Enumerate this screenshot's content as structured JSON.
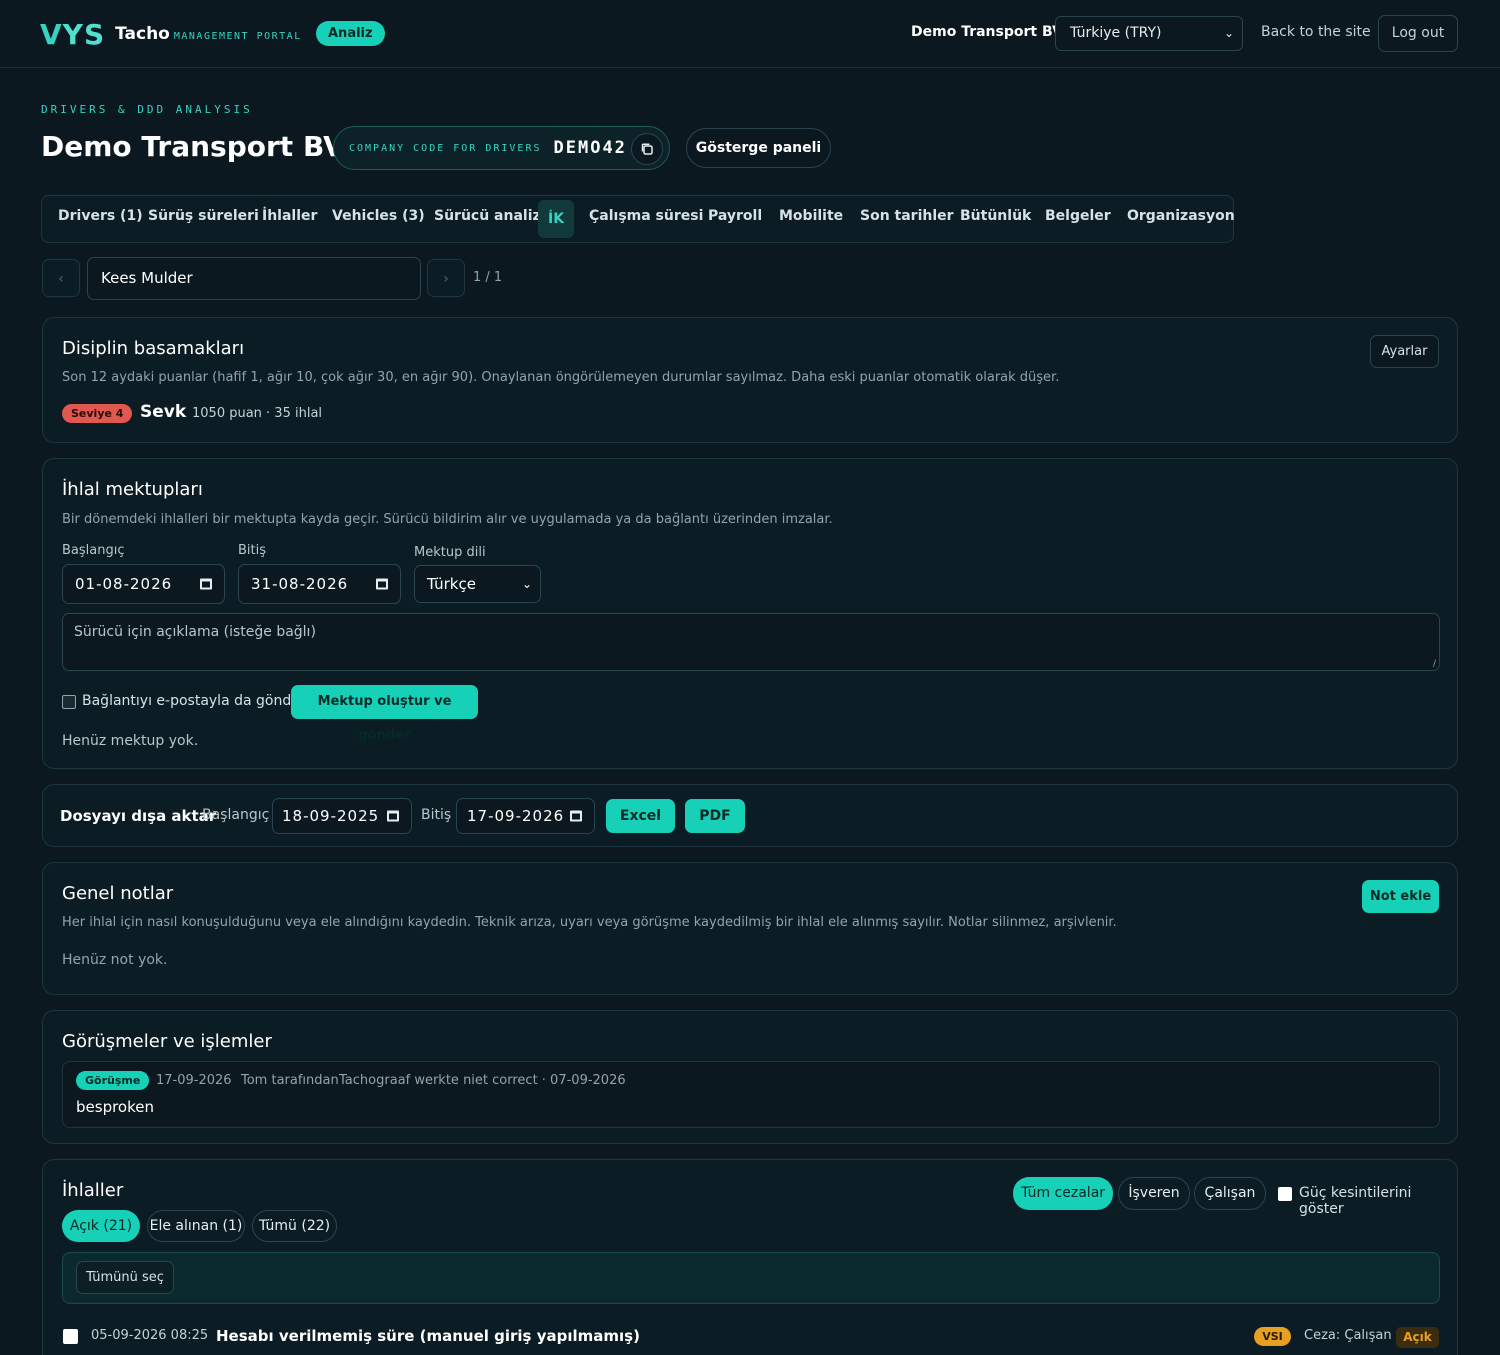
{
  "header": {
    "logo_mark_v": "V",
    "logo_mark_ys": "YS",
    "logo_text": "Tacho",
    "logo_sub": "MANAGEMENT PORTAL",
    "analiz_badge": "Analiz",
    "company": "Demo Transport BV",
    "country_select": "Türkiye (TRY)",
    "back_link": "Back to the site",
    "logout": "Log out"
  },
  "page": {
    "eyebrow": "DRIVERS & DDD ANALYSIS",
    "title": "Demo Transport BV",
    "code_label": "COMPANY CODE FOR DRIVERS",
    "code_value": "DEMO42",
    "dashboard_button": "Gösterge paneli"
  },
  "tabs": [
    "Drivers (1)",
    "Sürüş süreleri",
    "İhlaller",
    "Vehicles (3)",
    "Sürücü analizi",
    "İK",
    "Çalışma süresi",
    "Payroll",
    "Mobilite",
    "Son tarihler",
    "Bütünlük",
    "Belgeler",
    "Organizasyon"
  ],
  "active_tab": "İK",
  "driver_selector": {
    "prev": "‹",
    "next": "›",
    "name": "Kees Mulder",
    "pager": "1 / 1"
  },
  "discipline": {
    "title": "Disiplin basamakları",
    "description": "Son 12 aydaki puanlar (hafif 1, ağır 10, çok ağır 30, en ağır 90). Onaylanan öngörülemeyen durumlar sayılmaz. Daha eski puanlar otomatik olarak düşer.",
    "settings_button": "Ayarlar",
    "level_badge": "Seviye 4",
    "level_name": "Sevk",
    "level_stats": "1050 puan · 35 ihlal"
  },
  "letters": {
    "title": "İhlal mektupları",
    "description": "Bir dönemdeki ihlalleri bir mektupta kayda geçir. Sürücü bildirim alır ve uygulamada ya da bağlantı üzerinden imzalar.",
    "start_label": "Başlangıç",
    "start_value": "01-08-2026",
    "end_label": "Bitiş",
    "end_value": "31-08-2026",
    "lang_label": "Mektup dili",
    "lang_value": "Türkçe",
    "note_placeholder": "Sürücü için açıklama (isteğe bağlı)",
    "email_checkbox": "Bağlantıyı e-postayla da gönder",
    "submit_button": "Mektup oluştur ve gönder",
    "empty": "Henüz mektup yok."
  },
  "export": {
    "title": "Dosyayı dışa aktar",
    "start_label": "Başlangıç",
    "start_value": "18-09-2025",
    "end_label": "Bitiş",
    "end_value": "17-09-2026",
    "excel_button": "Excel",
    "pdf_button": "PDF"
  },
  "notes": {
    "title": "Genel notlar",
    "description": "Her ihlal için nasıl konuşulduğunu veya ele alındığını kaydedin. Teknik arıza, uyarı veya görüşme kaydedilmiş bir ihlal ele alınmış sayılır. Notlar silinmez, arşivlenir.",
    "add_button": "Not ekle",
    "empty": "Henüz not yok."
  },
  "meetings": {
    "title": "Görüşmeler ve işlemler",
    "item": {
      "badge": "Görüşme",
      "date": "17-09-2026",
      "author": "Tom tarafından",
      "meta": "Tachograaf werkte niet correct · 07-09-2026",
      "text": "besproken"
    }
  },
  "violations": {
    "title": "İhlaller",
    "filters": [
      "Tüm cezalar",
      "İşveren",
      "Çalışan"
    ],
    "power_checkbox": "Güç kesintilerini göster",
    "status_tabs": [
      "Açık (21)",
      "Ele alınan (1)",
      "Tümü (22)"
    ],
    "select_all": "Tümünü seç",
    "row": {
      "datetime": "05-09-2026 08:25",
      "title": "Hesabı verilmemiş süre (manuel giriş yapılmamış)",
      "code_badge": "VSI",
      "penalty": "Ceza: Çalışan",
      "status": "Açık"
    }
  },
  "colors": {
    "accent": "#16d1b8",
    "danger": "#e0584f",
    "warning": "#e8a020",
    "background": "#0b1820"
  }
}
